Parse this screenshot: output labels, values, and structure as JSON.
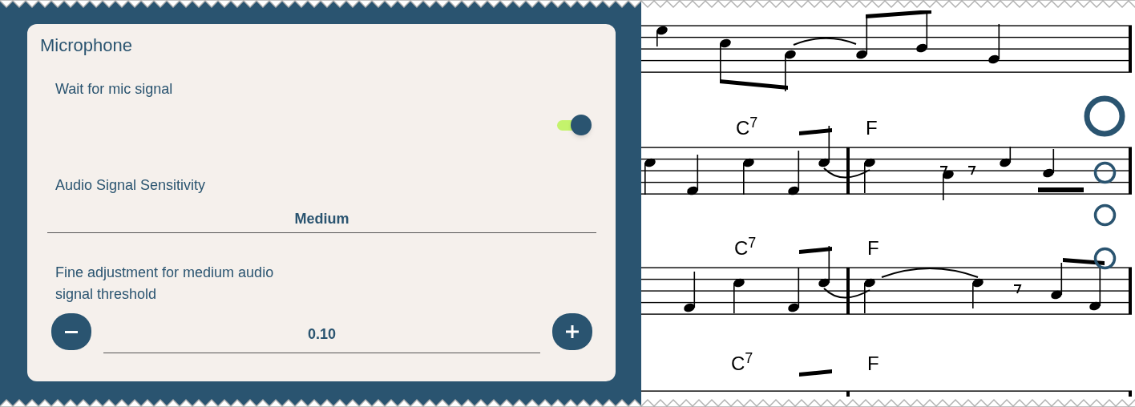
{
  "panel": {
    "title": "Microphone",
    "settings": [
      {
        "kind": "toggle",
        "label": "Wait for mic signal",
        "on": true
      },
      {
        "kind": "select",
        "label": "Audio Signal Sensitivity",
        "value": "Medium"
      },
      {
        "kind": "stepper",
        "label": "Fine adjustment for medium audio signal threshold",
        "value": "0.10"
      }
    ]
  },
  "score": {
    "chord_labels": [
      {
        "text": "C$^{7}$"
      },
      {
        "text": "F"
      },
      {
        "text": "C$^{7}$"
      },
      {
        "text": "F"
      },
      {
        "text": "C$^{7}$"
      },
      {
        "text": "F"
      }
    ]
  }
}
